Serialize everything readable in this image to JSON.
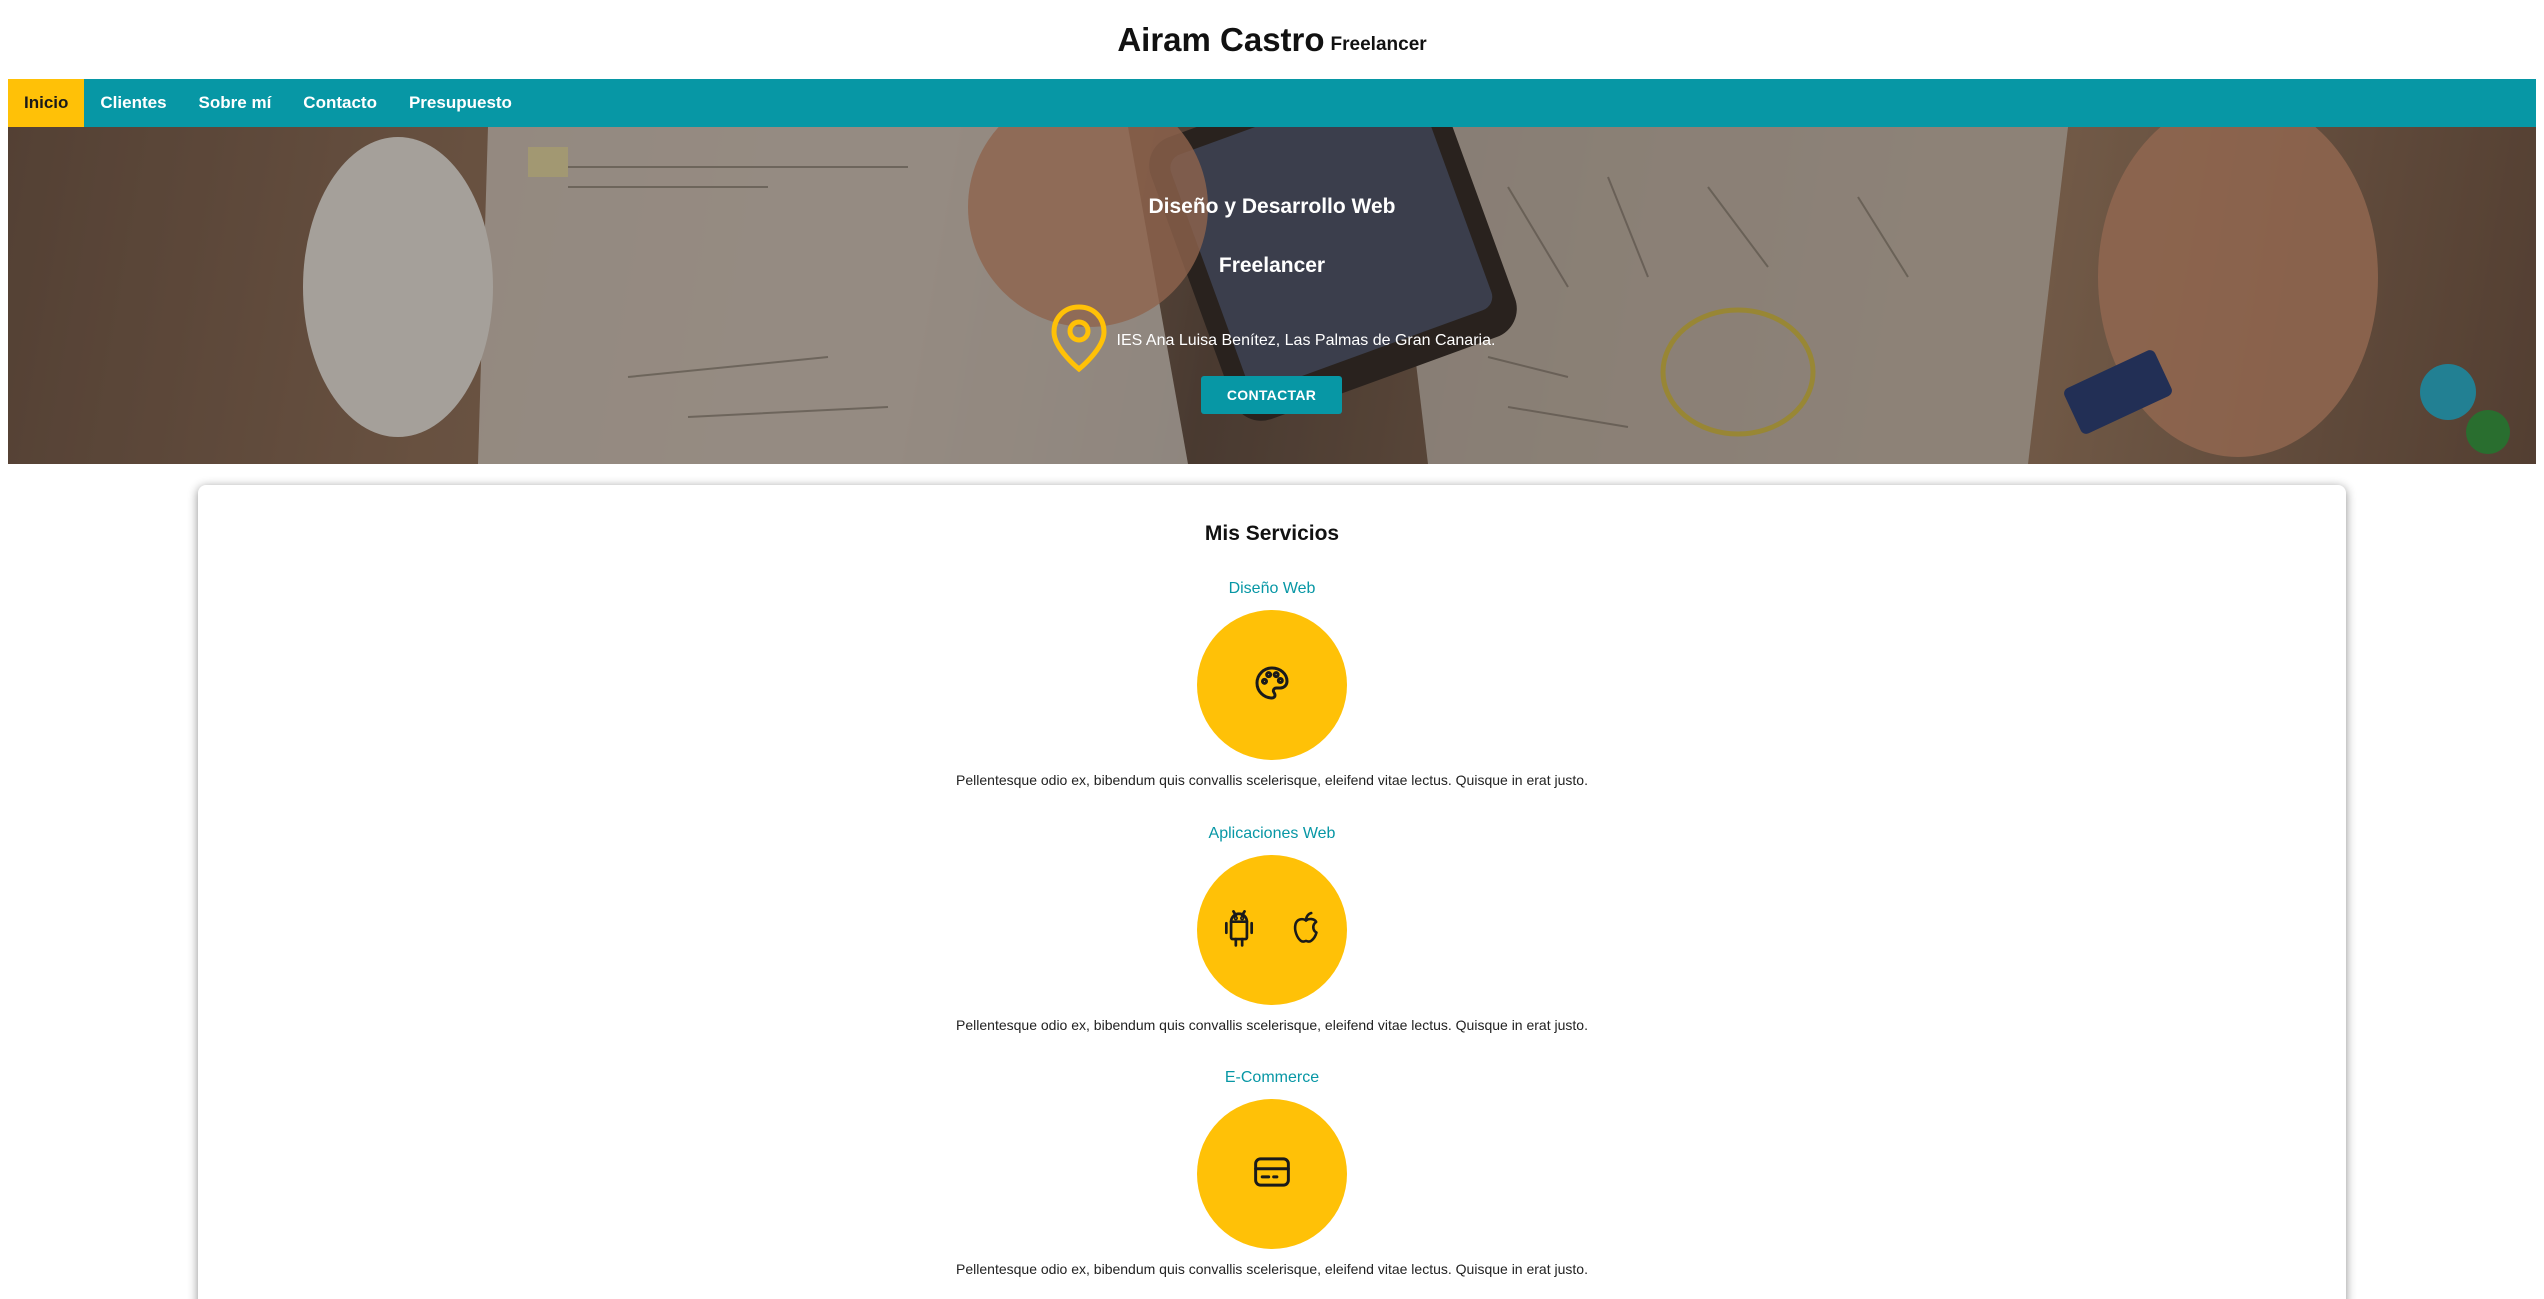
{
  "header": {
    "title": "Airam Castro",
    "subtitle": "Freelancer"
  },
  "nav": {
    "items": [
      {
        "label": "Inicio",
        "active": true
      },
      {
        "label": "Clientes"
      },
      {
        "label": "Sobre mí"
      },
      {
        "label": "Contacto"
      },
      {
        "label": "Presupuesto"
      }
    ]
  },
  "hero": {
    "line1": "Diseño y Desarrollo Web",
    "line2": "Freelancer",
    "location": "IES Ana Luisa Benítez, Las Palmas de Gran Canaria.",
    "location_icon": "map-pin-icon",
    "cta_label": "CONTACTAR"
  },
  "services": {
    "title": "Mis Servicios",
    "items": [
      {
        "name": "Diseño Web",
        "icons": [
          "palette-icon"
        ],
        "desc": "Pellentesque odio ex, bibendum quis convallis scelerisque, eleifend vitae lectus. Quisque in erat justo."
      },
      {
        "name": "Aplicaciones Web",
        "icons": [
          "android-icon",
          "apple-icon"
        ],
        "desc": "Pellentesque odio ex, bibendum quis convallis scelerisque, eleifend vitae lectus. Quisque in erat justo."
      },
      {
        "name": "E-Commerce",
        "icons": [
          "credit-card-icon"
        ],
        "desc": "Pellentesque odio ex, bibendum quis convallis scelerisque, eleifend vitae lectus. Quisque in erat justo."
      }
    ]
  },
  "colors": {
    "accent": "#0797a5",
    "highlight": "#ffc107"
  }
}
